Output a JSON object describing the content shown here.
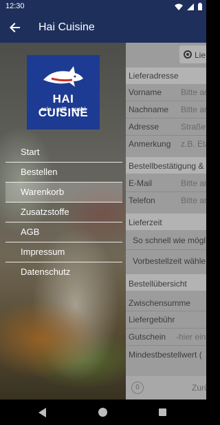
{
  "status_bar": {
    "time": "12:30"
  },
  "app_bar": {
    "title": "Hai Cuisine"
  },
  "logo": {
    "brand": "HAI CUISINE",
    "tagline": "asia · grill · sushi"
  },
  "menu": {
    "items": [
      {
        "label": "Start"
      },
      {
        "label": "Bestellen"
      },
      {
        "label": "Warenkorb",
        "active": true
      },
      {
        "label": "Zusatzstoffe"
      },
      {
        "label": "AGB"
      },
      {
        "label": "Impressum"
      },
      {
        "label": "Datenschutz"
      }
    ]
  },
  "background_form": {
    "delivery_option": "Lie",
    "section_delivery_address": "Lieferadresse",
    "fields": [
      {
        "label": "Vorname",
        "placeholder": "Bitte ar"
      },
      {
        "label": "Nachname",
        "placeholder": "Bitte ar"
      },
      {
        "label": "Adresse",
        "placeholder": "Straße"
      },
      {
        "label": "Anmerkung",
        "placeholder": "z.B. Eta"
      }
    ],
    "section_confirmation": "Bestellbestätigung &",
    "contact_fields": [
      {
        "label": "E-Mail",
        "placeholder": "Bitte ar"
      },
      {
        "label": "Telefon",
        "placeholder": "Bitte ar"
      }
    ],
    "section_delivery_time": "Lieferzeit",
    "time_option_asap": "So schnell wie mögl",
    "time_option_preorder": "Vorbestellzeit wähle",
    "section_summary": "Bestellübersicht",
    "subtotal_label": "Zwischensumme",
    "delivery_fee_label": "Liefergebühr",
    "voucher_label": "Gutschein",
    "voucher_placeholder": "-hier ein",
    "min_order_label": "Mindestbestellwert (",
    "cart_count": "0",
    "back_button_partial": "Zurü"
  }
}
